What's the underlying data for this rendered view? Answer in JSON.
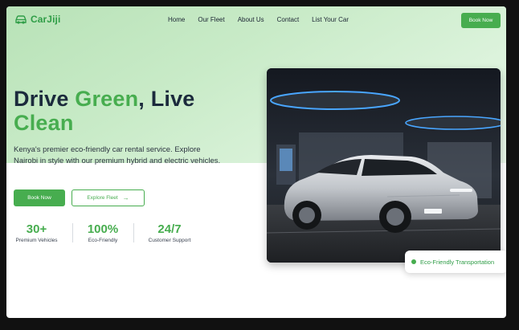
{
  "brand": {
    "name": "CarJiji",
    "accent": "#47ad4f",
    "logo_icon": "car-icon"
  },
  "nav": {
    "links": [
      "Home",
      "Our Fleet",
      "About Us",
      "Contact",
      "List Your Car"
    ],
    "cta": "Book Now"
  },
  "hero": {
    "headline_part1": "Drive ",
    "headline_green1": "Green",
    "headline_part2": ", Live",
    "headline_green2": "Clean",
    "tagline": "Kenya's premier eco-friendly car rental service. Explore Nairobi in style with our premium hybrid and electric vehicles.",
    "primary_button": "Book Now",
    "secondary_button": "Explore Fleet",
    "secondary_icon": "arrow-right-icon"
  },
  "stats": [
    {
      "value": "30+",
      "label": "Premium Vehicles"
    },
    {
      "value": "100%",
      "label": "Eco-Friendly"
    },
    {
      "value": "24/7",
      "label": "Customer Support"
    }
  ],
  "image": {
    "badge": "Eco-Friendly Transportation"
  }
}
